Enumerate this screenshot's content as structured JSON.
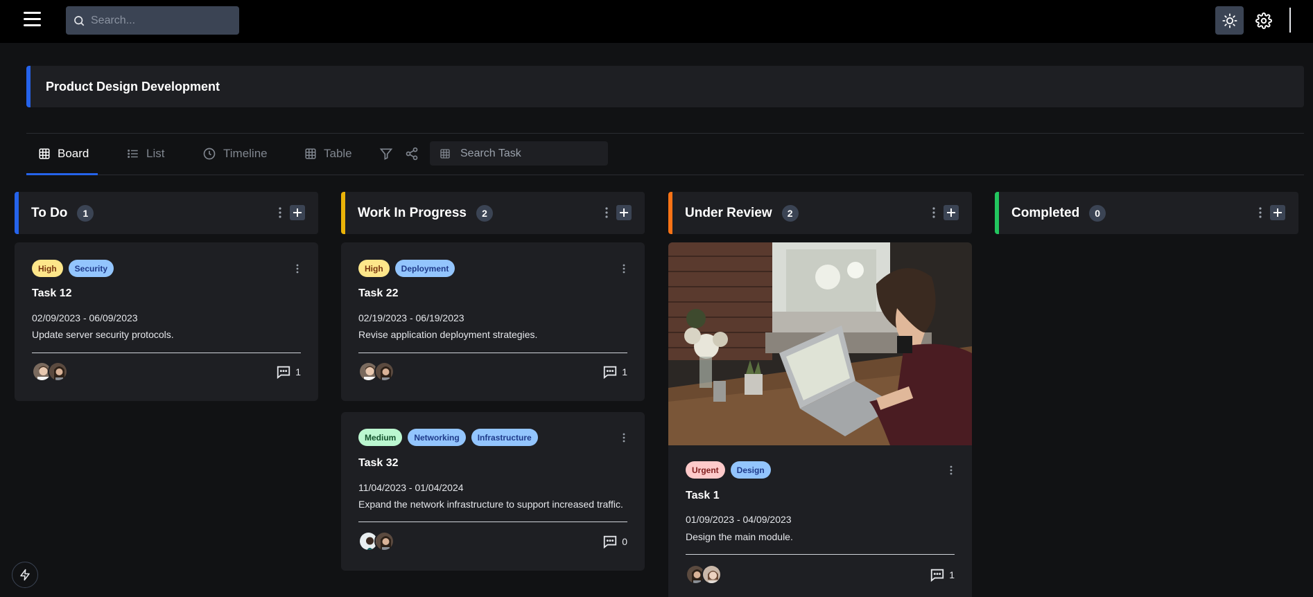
{
  "topbar": {
    "search_placeholder": "Search...",
    "icons": [
      "menu-icon",
      "search-icon",
      "sun-icon",
      "gear-icon"
    ]
  },
  "project": {
    "title": "Product Design Development"
  },
  "tabs": [
    {
      "label": "Board",
      "icon": "grid-icon",
      "active": true
    },
    {
      "label": "List",
      "icon": "list-icon",
      "active": false
    },
    {
      "label": "Timeline",
      "icon": "clock-icon",
      "active": false
    },
    {
      "label": "Table",
      "icon": "table-icon",
      "active": false
    }
  ],
  "toolbar": {
    "task_search_placeholder": "Search Task"
  },
  "columns": [
    {
      "title": "To Do",
      "count": "1",
      "color": "#2563eb"
    },
    {
      "title": "Work In Progress",
      "count": "2",
      "color": "#eab308"
    },
    {
      "title": "Under Review",
      "count": "2",
      "color": "#f97316"
    },
    {
      "title": "Completed",
      "count": "0",
      "color": "#22c55e"
    }
  ],
  "colors": {
    "tag_high": "#fde68a",
    "tag_medium": "#bbf7d0",
    "tag_urgent": "#fecaca",
    "tag_category": "#93c5fd"
  },
  "cards": {
    "task12": {
      "tags": [
        "High",
        "Security"
      ],
      "title": "Task 12",
      "dates": "02/09/2023 - 06/09/2023",
      "description": "Update server security protocols.",
      "comments": "1"
    },
    "task22": {
      "tags": [
        "High",
        "Deployment"
      ],
      "title": "Task 22",
      "dates": "02/19/2023 - 06/19/2023",
      "description": "Revise application deployment strategies.",
      "comments": "1"
    },
    "task32": {
      "tags": [
        "Medium",
        "Networking",
        "Infrastructure"
      ],
      "title": "Task 32",
      "dates": "11/04/2023 - 01/04/2024",
      "description": "Expand the network infrastructure to support increased traffic.",
      "comments": "0"
    },
    "task1": {
      "tags": [
        "Urgent",
        "Design"
      ],
      "title": "Task 1",
      "dates": "01/09/2023 - 04/09/2023",
      "description": "Design the main module.",
      "comments": "1"
    }
  }
}
